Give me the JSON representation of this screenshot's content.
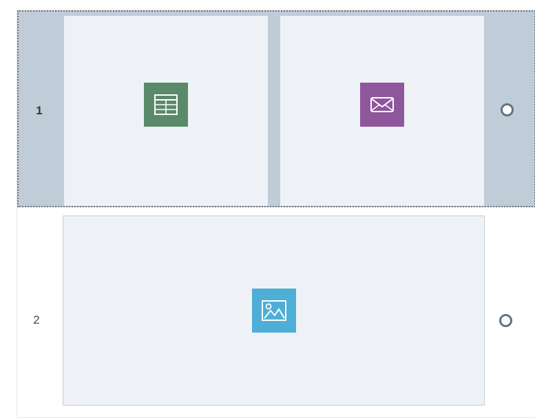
{
  "rows": [
    {
      "number": "1",
      "selected": true,
      "cells": [
        {
          "content_type": "table",
          "icon": "table-icon",
          "color": "#5a8a6a"
        },
        {
          "content_type": "email",
          "icon": "envelope-icon",
          "color": "#8e579b"
        }
      ]
    },
    {
      "number": "2",
      "selected": false,
      "cells": [
        {
          "content_type": "image",
          "icon": "image-icon",
          "color": "#4faed6"
        }
      ]
    }
  ],
  "colors": {
    "selected_row_bg": "#c0ccd8",
    "cell_bg": "#eef2f6",
    "radio_border": "#5f7480"
  }
}
